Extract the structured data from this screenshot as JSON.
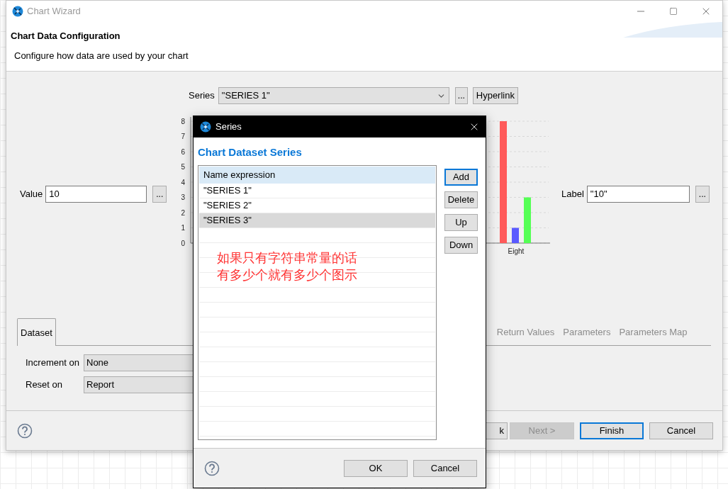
{
  "wizard": {
    "title": "Chart Wizard",
    "heading": "Chart Data Configuration",
    "description": "Configure how data are used by your chart",
    "series_field": {
      "label": "Series",
      "value": "\"SERIES 1\"",
      "more": "...",
      "extra_button": "Hyperlink"
    },
    "value_field": {
      "label": "Value",
      "value": "10",
      "more": "..."
    },
    "label_field": {
      "label": "Label",
      "value": "\"10\"",
      "more": "..."
    },
    "chart": {
      "chart_data": {
        "type": "bar",
        "categories": [
          "Eight"
        ],
        "yticks": [
          0,
          1,
          2,
          3,
          4,
          5,
          6,
          7,
          8
        ],
        "ylim": [
          0,
          8
        ],
        "grid": true,
        "series": [
          {
            "color": "#ff5a5a",
            "values": [
              8
            ]
          },
          {
            "color": "#5a5aff",
            "values": [
              1
            ]
          },
          {
            "color": "#55ff55",
            "values": [
              3
            ]
          }
        ]
      }
    },
    "tabs": [
      {
        "label": "Dataset",
        "selected": true
      },
      {
        "label": "Return Values",
        "selected": false
      },
      {
        "label": "Parameters",
        "selected": false
      },
      {
        "label": "Parameters Map",
        "selected": false
      }
    ],
    "dataset_fields": [
      {
        "label": "Increment on",
        "value": "None"
      },
      {
        "label": "Reset on",
        "value": "Report"
      }
    ],
    "buttons": [
      {
        "label": "k",
        "disabled": false,
        "focused": false
      },
      {
        "label": "Next >",
        "disabled": true,
        "focused": false
      },
      {
        "label": "Finish",
        "disabled": false,
        "focused": true
      },
      {
        "label": "Cancel",
        "disabled": false,
        "focused": false
      }
    ]
  },
  "dialog": {
    "title": "Series",
    "heading": "Chart Dataset Series",
    "table": {
      "columns": [
        "Name expression"
      ],
      "rows": [
        {
          "cells": [
            "\"SERIES 1\""
          ],
          "selected": false
        },
        {
          "cells": [
            "\"SERIES 2\""
          ],
          "selected": false
        },
        {
          "cells": [
            "\"SERIES 3\""
          ],
          "selected": true
        }
      ]
    },
    "note": [
      "如果只有字符串常量的话",
      "有多少个就有多少个图示"
    ],
    "side_buttons": [
      {
        "label": "Add",
        "focused": true
      },
      {
        "label": "Delete",
        "focused": false
      },
      {
        "label": "Up",
        "focused": false
      },
      {
        "label": "Down",
        "focused": false
      }
    ],
    "buttons": [
      "OK",
      "Cancel"
    ]
  }
}
